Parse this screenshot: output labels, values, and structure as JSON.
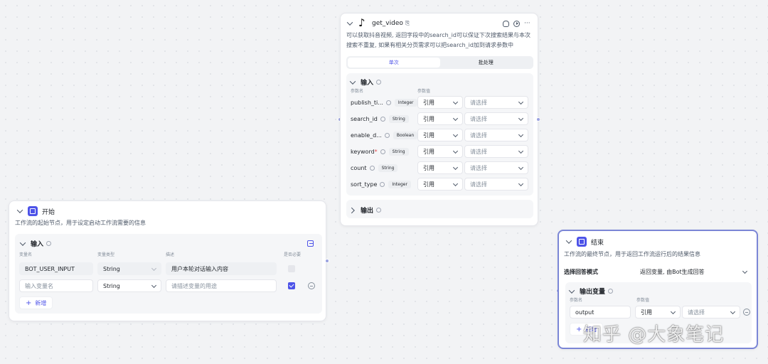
{
  "start_node": {
    "title": "开始",
    "description": "工作流的起始节点，用于设定启动工作流需要的信息",
    "input_section": {
      "title": "输入",
      "columns": [
        "变量名",
        "变量类型",
        "描述",
        "是否必要"
      ],
      "rows": [
        {
          "name": "BOT_USER_INPUT",
          "type": "String",
          "description": "用户本轮对话输入内容",
          "required": false,
          "disabled": true
        },
        {
          "name": "",
          "name_placeholder": "输入变量名",
          "type": "String",
          "description": "",
          "description_placeholder": "请描述变量的用途",
          "required": true,
          "disabled": false
        }
      ],
      "add_label": "新增"
    }
  },
  "video_node": {
    "title": "get_video",
    "description": "可以获取抖音视频, 返回字段中的search_id可以保证下次搜索结果与本次搜索不重复, 如果有相关分页需求可以把search_id加到请求参数中",
    "tabs": [
      {
        "label": "单次",
        "active": true
      },
      {
        "label": "批处理",
        "active": false
      }
    ],
    "input_section": {
      "title": "输入",
      "columns": [
        "参数名",
        "参数值"
      ],
      "params": [
        {
          "name": "publish_ti...",
          "required": false,
          "type": "Integer",
          "mode": "引用",
          "value_placeholder": "请选择"
        },
        {
          "name": "search_id",
          "required": false,
          "type": "String",
          "mode": "引用",
          "value_placeholder": "请选择"
        },
        {
          "name": "enable_d...",
          "required": false,
          "type": "Boolean",
          "mode": "引用",
          "value_placeholder": "请选择"
        },
        {
          "name": "keyword",
          "required": true,
          "type": "String",
          "mode": "引用",
          "value_placeholder": "请选择"
        },
        {
          "name": "count",
          "required": false,
          "type": "String",
          "mode": "引用",
          "value_placeholder": "请选择"
        },
        {
          "name": "sort_type",
          "required": false,
          "type": "Integer",
          "mode": "引用",
          "value_placeholder": "请选择"
        }
      ]
    },
    "output_section": {
      "title": "输出"
    }
  },
  "end_node": {
    "title": "结束",
    "description": "工作流的最终节点，用于返回工作流运行后的结果信息",
    "answer_mode_label": "选择回答模式",
    "answer_mode_value": "返回变量, 由Bot生成回答",
    "output_section": {
      "title": "输出变量",
      "columns": [
        "参数名",
        "参数值"
      ],
      "rows": [
        {
          "name": "output",
          "mode": "引用",
          "value_placeholder": "请选择"
        }
      ],
      "add_label": "新增"
    }
  },
  "watermark": "知乎 @大象笔记",
  "colors": {
    "accent": "#4d53e8",
    "canvas": "#f2f3f5",
    "selected_border": "#7b86d6"
  }
}
